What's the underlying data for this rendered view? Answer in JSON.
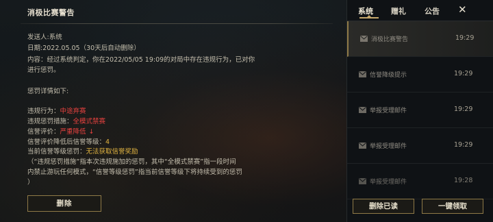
{
  "detail": {
    "title": "消极比赛警告",
    "sender_label": "发送人:",
    "sender_value": "系统",
    "date_label": "日期:",
    "date_value": "2022.05.05",
    "date_note": "（30天后自动删除）",
    "content_line1": "内容：经过系统判定，你在2022/05/05 19:09的对局中存在违规行为，已对你",
    "content_line2": "进行惩罚。",
    "penalty_header": "惩罚详情如下:",
    "violation_label": "违规行为：",
    "violation_value": "中途弃赛",
    "measure_label": "违规惩罚措施：",
    "measure_value": "全模式禁赛",
    "credit_label": "信誉评价：",
    "credit_value": "严重降低",
    "credit_arrow": "↓",
    "level_drop_label": "信誉评价降低后信誉等级：",
    "level_drop_value": "4",
    "current_level_label": "当前信誉等级惩罚：",
    "current_level_value": "无法获取信誉奖励",
    "note_line1": "（“违规惩罚措施”指本次违规施加的惩罚，其中“全模式禁赛”指一段时间",
    "note_line2": "内禁止游玩任何模式，“信誉等级惩罚”指当前信誉等级下将持续受到的惩罚",
    "note_line3": "）",
    "delete_button": "删除"
  },
  "sidebar": {
    "tabs": [
      {
        "label": "系统",
        "active": true
      },
      {
        "label": "赠礼",
        "active": false
      },
      {
        "label": "公告",
        "active": false
      }
    ],
    "close_icon": "close-icon",
    "mails": [
      {
        "subject": "消极比赛警告",
        "time": "19:29",
        "selected": true
      },
      {
        "subject": "信誉降级提示",
        "time": "19:29",
        "selected": false
      },
      {
        "subject": "举报受理邮件",
        "time": "19:29",
        "selected": false
      },
      {
        "subject": "举报受理邮件",
        "time": "19:29",
        "selected": false
      },
      {
        "subject": "举报受理邮件",
        "time": "19:28",
        "selected": false
      }
    ],
    "delete_read_button": "删除已读",
    "claim_all_button": "一键领取"
  },
  "colors": {
    "accent_gold": "#c8aa6e",
    "warning_red": "#e8423f",
    "highlight_gold": "#e0b341"
  }
}
